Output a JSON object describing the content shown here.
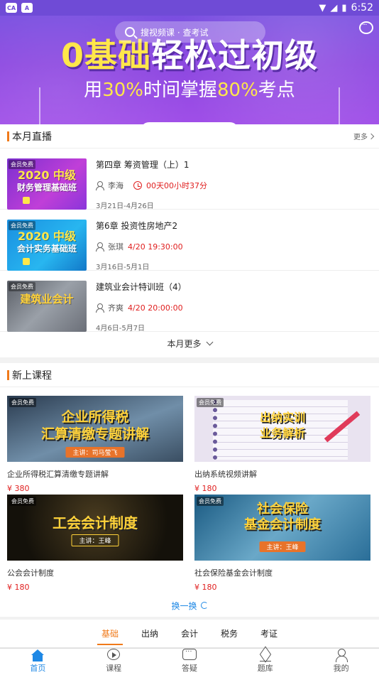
{
  "status_bar": {
    "time": "6:52",
    "app_badge": "A",
    "app_logo": "CA"
  },
  "hero": {
    "search_placeholder": "搜视频课 · 查考试",
    "title_part1": "0基础",
    "title_part2": "轻松过初级",
    "subtitle_part1": "用",
    "subtitle_pct1": "30%",
    "subtitle_part2": "时间掌握",
    "subtitle_pct2": "80%",
    "subtitle_part3": "考点"
  },
  "live_section": {
    "title": "本月直播",
    "more_label": "更多",
    "items": [
      {
        "badge": "会员免费",
        "thumb_year": "2020 中级",
        "thumb_title": "财务管理基础班",
        "title": "第四章 筹资管理（上）1",
        "teacher": "李海",
        "status": "00天00小时37分",
        "dates": "3月21日-4月26日"
      },
      {
        "badge": "会员免费",
        "thumb_year": "2020 中级",
        "thumb_title": "会计实务基础班",
        "title": "第6章 投资性房地产2",
        "teacher": "张琪",
        "status": "4/20 19:30:00",
        "dates": "3月16日-5月1日"
      },
      {
        "badge": "会员免费",
        "thumb_year": "",
        "thumb_title": "建筑业会计",
        "title": "建筑业会计特训班（4）",
        "teacher": "齐爽",
        "status": "4/20 20:00:00",
        "dates": "4月6日-5月7日"
      }
    ],
    "month_more_label": "本月更多"
  },
  "new_section": {
    "title": "新上课程",
    "courses": [
      {
        "badge": "会员免费",
        "headline": "企业所得税\n汇算清缴专题讲解",
        "speaker": "主讲：司马莹飞",
        "title": "企业所得税汇算清缴专题讲解",
        "price": "¥ 380"
      },
      {
        "badge": "会员免费",
        "headline": "出纳实训\n业务解析",
        "speaker": "",
        "title": "出纳系统视频讲解",
        "price": "¥ 180"
      },
      {
        "badge": "会员免费",
        "headline": "工会会计制度",
        "speaker": "主讲：王峰",
        "title": "公会会计制度",
        "price": "¥ 180"
      },
      {
        "badge": "会员免费",
        "headline": "社会保险\n基金会计制度",
        "speaker": "主讲：王峰",
        "title": "社会保险基金会计制度",
        "price": "¥ 180"
      }
    ],
    "swap_label": "换一换"
  },
  "category_tabs": [
    "基础",
    "出纳",
    "会计",
    "税务",
    "考证"
  ],
  "bottom_nav": [
    {
      "label": "首页",
      "icon": "home-icon",
      "active": true
    },
    {
      "label": "课程",
      "icon": "play-circle-icon",
      "active": false
    },
    {
      "label": "答疑",
      "icon": "chat-icon",
      "active": false
    },
    {
      "label": "题库",
      "icon": "layers-icon",
      "active": false
    },
    {
      "label": "我的",
      "icon": "user-icon",
      "active": false
    }
  ],
  "colors": {
    "accent_orange": "#f07a1a",
    "accent_blue": "#1e88e5",
    "price_red": "#e02020",
    "hero_purple": "#7a4fe0"
  }
}
